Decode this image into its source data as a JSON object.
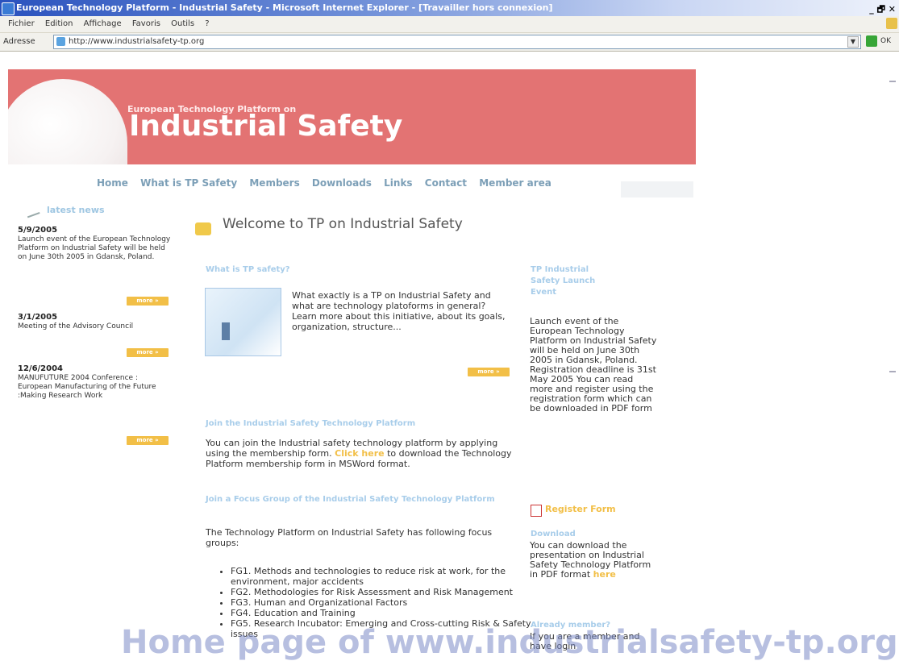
{
  "window": {
    "title": "European Technology Platform - Industrial Safety - Microsoft Internet Explorer - [Travailler hors connexion]",
    "controls": "_ 🗗 ✕"
  },
  "menu": [
    "Fichier",
    "Edition",
    "Affichage",
    "Favoris",
    "Outils",
    "?"
  ],
  "address": {
    "label": "Adresse",
    "url": "http://www.industrialsafety-tp.org",
    "go_label": "OK"
  },
  "banner": {
    "subtitle": "European Technology Platform on",
    "title": "Industrial Safety"
  },
  "nav": [
    "Home",
    "What is TP Safety",
    "Members",
    "Downloads",
    "Links",
    "Contact",
    "Member area"
  ],
  "latest": {
    "title": "latest news",
    "more_label": "more »",
    "items": [
      {
        "date": "5/9/2005",
        "text": "Launch event of the European Technology Platform on Industrial Safety will be held on June 30th 2005 in Gdansk, Poland."
      },
      {
        "date": "3/1/2005",
        "text": "Meeting of the Advisory Council"
      },
      {
        "date": "12/6/2004",
        "text": "MANUFUTURE 2004 Conference : European Manufacturing of the Future :Making Research Work"
      }
    ]
  },
  "main": {
    "welcome": "Welcome to TP on Industrial Safety",
    "what_title": "What is TP safety?",
    "what_text": "What exactly is a TP on Industrial Safety and what are technology platoforms in general? Learn more about this initiative, about its goals, organization, structure...",
    "join_title": "Join the Industrial Safety Technology Platform",
    "join_text_1": "You can join the Industrial safety technology platform by applying using the membership form.",
    "join_link": "Click here",
    "join_text_2": "to download the Technology Platform membership form in MSWord format.",
    "focus_title": "Join a Focus Group of the Industrial Safety Technology Platform",
    "focus_text": "The Technology Platform on Industrial Safety has following focus groups:",
    "focus_groups": [
      "FG1. Methods and technologies to reduce risk at work, for the environment, major accidents",
      "FG2. Methodologies for Risk Assessment and Risk Management",
      "FG3. Human and Organizational Factors",
      "FG4. Education and Training",
      "FG5. Research Incubator: Emerging and Cross-cutting Risk & Safety issues"
    ]
  },
  "right": {
    "launch_title": "TP Industrial Safety Launch Event",
    "launch_text": "Launch event of the European Technology Platform on Industrial Safety will be held on June 30th 2005 in Gdansk, Poland. Registration deadline is 31st May 2005 You can read more and register using the registration form which can be downloaded in PDF form",
    "register_label": "Register Form",
    "download_title": "Download",
    "download_text": "You can download the presentation on Industrial Safety Technology Platform in PDF format",
    "download_link": "here",
    "member_title": "Already member?",
    "member_text": "If you are a member and have login"
  },
  "watermark": "Home page of www.industrialsafety-tp.org"
}
